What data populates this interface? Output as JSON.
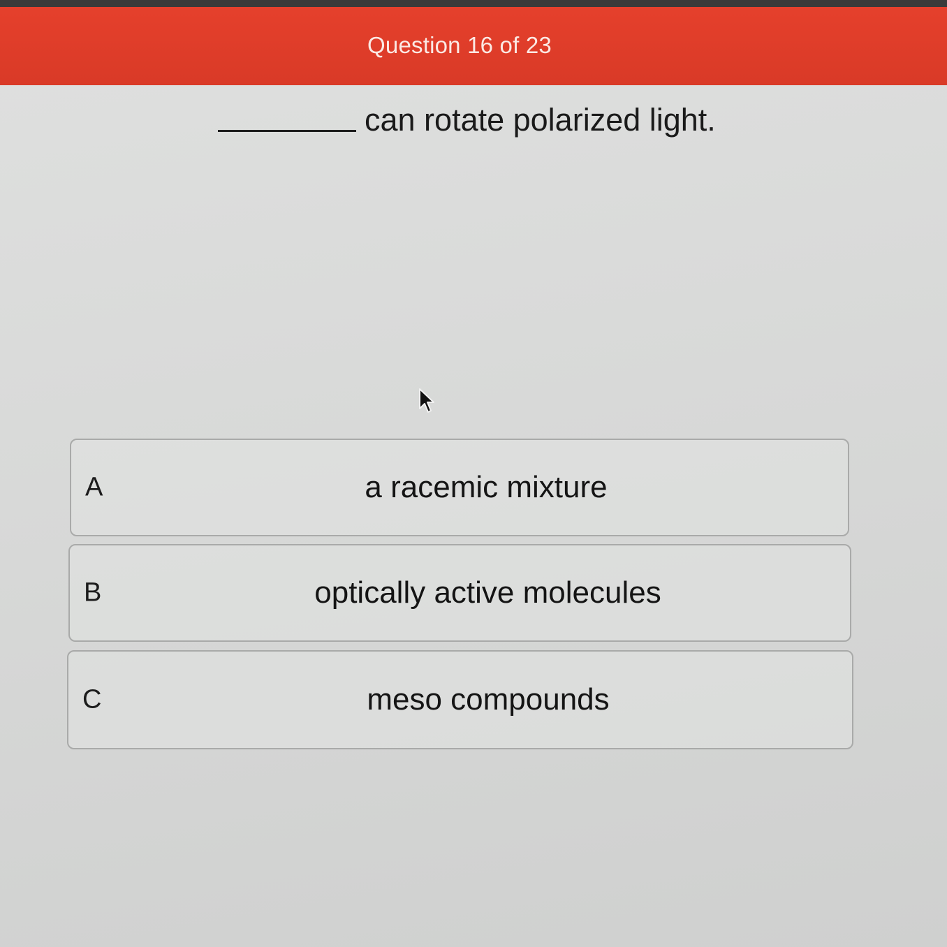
{
  "header": {
    "title": "Question 16 of 23",
    "color": "#e0402b"
  },
  "question": {
    "text": "can rotate polarized light."
  },
  "options": [
    {
      "letter": "A",
      "text": "a racemic mixture"
    },
    {
      "letter": "B",
      "text": "optically active molecules"
    },
    {
      "letter": "C",
      "text": "meso compounds"
    }
  ],
  "icons": {
    "cursor": "mouse-pointer-icon"
  }
}
